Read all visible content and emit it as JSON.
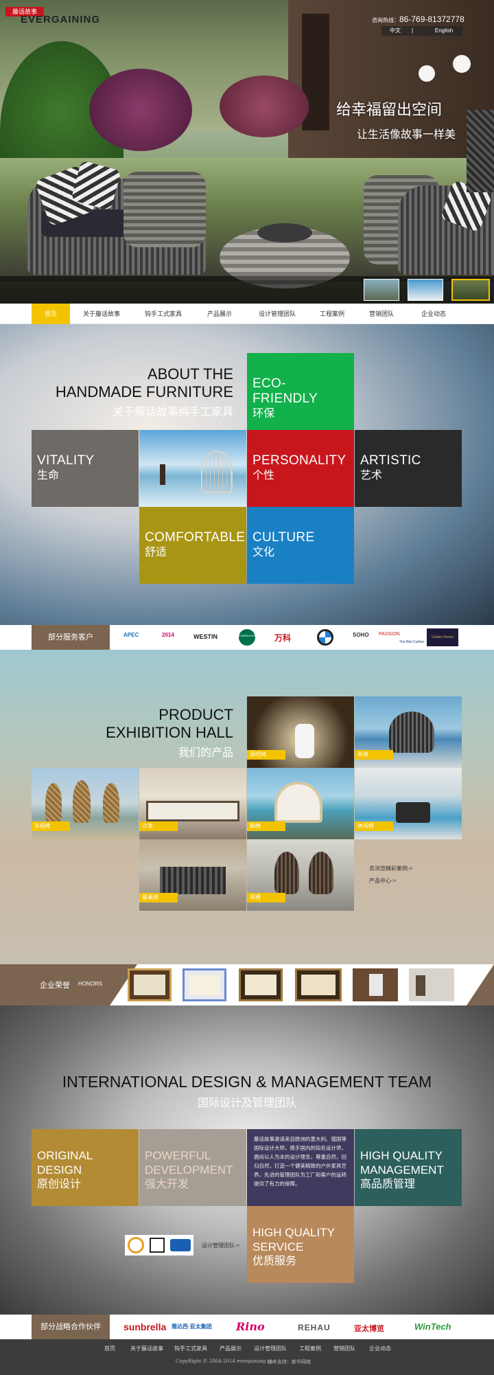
{
  "header": {
    "logo_cn": "藤话故事",
    "logo_en": "EVERGAINING",
    "hotline_label": "咨询热线：",
    "hotline_number": "86-769-81372778",
    "lang_cn": "中文",
    "lang_sep": "|",
    "lang_en": "English",
    "slogan_line1": "给幸福留出空间",
    "slogan_line2": "让生活像故事一样美"
  },
  "nav": {
    "items": [
      "首页",
      "关于藤话故事",
      "钩手工式家具",
      "产品展示",
      "设计管理团队",
      "工程案例",
      "营销团队",
      "企业动态"
    ],
    "active_index": 0
  },
  "about": {
    "title_line1": "ABOUT THE",
    "title_line2": "HANDMADE FURNITURE",
    "title_cn": "关于藤话故事纯手工家具",
    "tiles": [
      {
        "en": "ECO-FRIENDLY",
        "cn": "环保",
        "color": "#12b14b"
      },
      {
        "en": "VITALITY",
        "cn": "生命",
        "color": "#6e6a66"
      },
      {
        "en": "PERSONALITY",
        "cn": "个性",
        "color": "#c8161d"
      },
      {
        "en": "ARTISTIC",
        "cn": "艺术",
        "color": "#2a2a2a"
      },
      {
        "en": "COMFORTABLE",
        "cn": "舒适",
        "color": "#a99514"
      },
      {
        "en": "CULTURE",
        "cn": "文化",
        "color": "#1a80c4"
      }
    ]
  },
  "clients": {
    "label": "部分服务客户",
    "logos": [
      "APEC",
      "2014",
      "WESTIN",
      "STARBUCKS",
      "万科",
      "BMW",
      "SOHO",
      "PASSION",
      "The Ritz-Carlton",
      "Golden Ranch"
    ]
  },
  "products": {
    "title_line1": "PRODUCT",
    "title_line2": "EXHIBITION HALL",
    "title_cn": "我们的产品",
    "items": [
      "酒吧椅",
      "吊椅",
      "휴闲椅",
      "沙发",
      "躺椅",
      "休闲椅",
      "餐桌椅",
      "吊椅"
    ],
    "link_cases": "去浏览精彩案例->",
    "link_center": "产品中心->"
  },
  "honors": {
    "label_cn": "企业荣誉",
    "label_en": "HONORS"
  },
  "team": {
    "title_en": "INTERNATIONAL DESIGN & MANAGEMENT TEAM",
    "title_cn": "国际设计及管理团队",
    "tiles": [
      {
        "en1": "ORIGINAL",
        "en2": "DESIGN",
        "cn": "原创设计",
        "color": "#b38b35"
      },
      {
        "en1": "POWERFUL",
        "en2": "DEVELOPMENT",
        "cn": "强大开发",
        "color": "#a59e94"
      },
      {
        "en1": "HIGH QUALITY",
        "en2": "MANAGEMENT",
        "cn": "高品质管理",
        "color": "#2d5f5c"
      },
      {
        "en1": "HIGH QUALITY",
        "en2": "SERVICE",
        "cn": "优质服务",
        "color": "#b8895a"
      }
    ],
    "description": "藤话故事邀请来自欧洲的意大利、德国等国际设计大师，携手国内的知名设计师，倡尚以人为本的设计理念，尊重自然，回归自然，打造一个健美精致的户外家具世界。先进的管理团队为工厂和客户的运转提供了有力的保障。",
    "description_bg": "#3f3a5e",
    "link": "设计管理团队->"
  },
  "partners": {
    "label": "部分战略合作伙伴",
    "logos": [
      {
        "name": "sunbrella",
        "color": "#c8161d"
      },
      {
        "name": "雅达西·亚太集团",
        "color": "#1a5fb4"
      },
      {
        "name": "Rino",
        "color": "#d4006b"
      },
      {
        "name": "REHAU",
        "color": "#555555"
      },
      {
        "name": "亚太博览",
        "color": "#c8161d"
      },
      {
        "name": "WinTech",
        "color": "#2e9b3a"
      }
    ]
  },
  "footer": {
    "links": [
      "首页",
      "关于藤话故事",
      "钩手工式家具",
      "产品展示",
      "设计管理团队",
      "工程案例",
      "营销团队",
      "企业动态"
    ],
    "copyright": "CopyRight © 2004-2014 evergaining.cn",
    "support": "技术支持：新华网络"
  }
}
